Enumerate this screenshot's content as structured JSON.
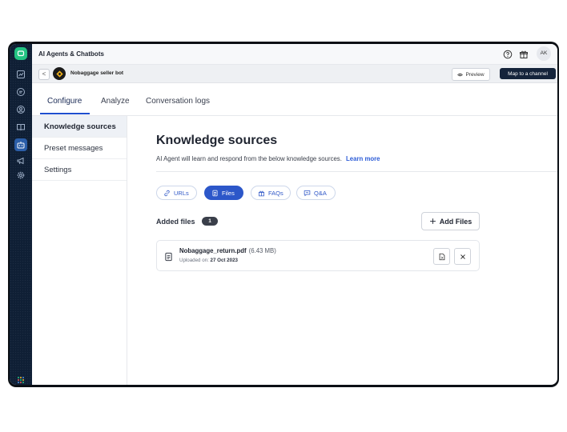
{
  "header": {
    "app_title": "AI Agents & Chatbots",
    "avatar_initials": "AK"
  },
  "botbar": {
    "back_label": "<",
    "bot_name": "Nobaggage seller bot",
    "preview_label": "Preview",
    "map_label": "Map to a channel"
  },
  "tabs": [
    {
      "label": "Configure",
      "active": true
    },
    {
      "label": "Analyze",
      "active": false
    },
    {
      "label": "Conversation logs",
      "active": false
    }
  ],
  "submenu": [
    {
      "label": "Knowledge sources",
      "active": true
    },
    {
      "label": "Preset messages",
      "active": false
    },
    {
      "label": "Settings",
      "active": false
    }
  ],
  "main": {
    "heading": "Knowledge sources",
    "subtitle": "AI Agent will learn and respond from the below knowledge sources.",
    "learn_more": "Learn more",
    "source_tabs": [
      {
        "label": "URLs",
        "icon": "link-icon",
        "active": false
      },
      {
        "label": "Files",
        "icon": "file-icon",
        "active": true
      },
      {
        "label": "FAQs",
        "icon": "faq-icon",
        "active": false
      },
      {
        "label": "Q&A",
        "icon": "chat-icon",
        "active": false
      }
    ],
    "added_files_label": "Added files",
    "added_files_count": "1",
    "add_files_label": "Add Files",
    "files": [
      {
        "name": "Nobaggage_return.pdf",
        "size": "(6.43 MB)",
        "uploaded_prefix": "Uploaded on:",
        "uploaded_date": "27 Oct 2023"
      }
    ]
  },
  "colors": {
    "accent": "#2c57c9",
    "rail": "#0f1f35",
    "logo": "#23c483",
    "map_button": "#15243b"
  }
}
